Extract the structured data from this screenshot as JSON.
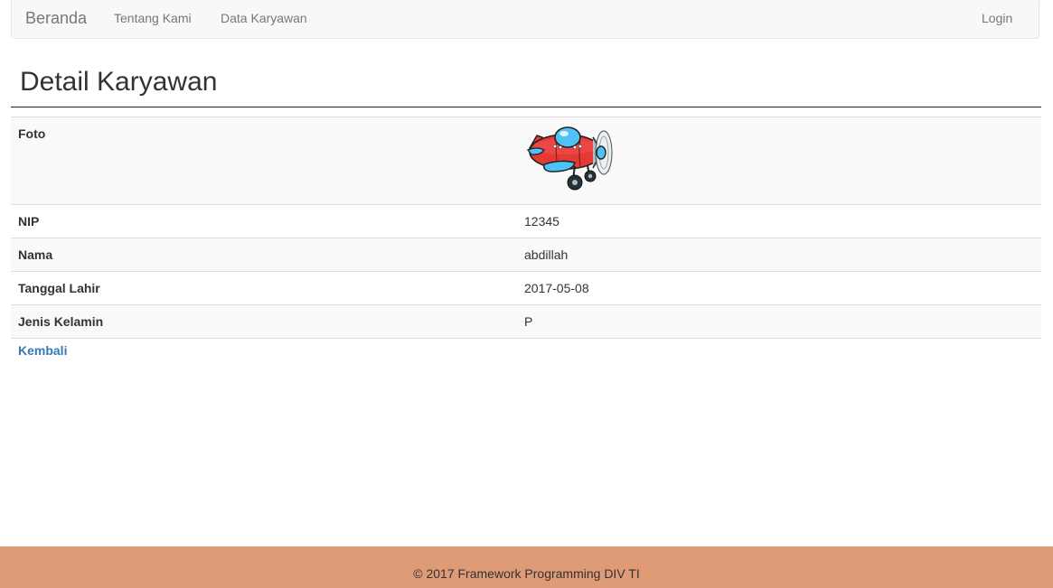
{
  "navbar": {
    "brand": "Beranda",
    "links": [
      "Tentang Kami",
      "Data Karyawan"
    ],
    "login": "Login"
  },
  "page": {
    "title": "Detail Karyawan",
    "rows": [
      {
        "label": "Foto",
        "value": ""
      },
      {
        "label": "NIP",
        "value": "12345"
      },
      {
        "label": "Nama",
        "value": "abdillah"
      },
      {
        "label": "Tanggal Lahir",
        "value": "2017-05-08"
      },
      {
        "label": "Jenis Kelamin",
        "value": "P"
      }
    ],
    "photo_icon": "airplane-cartoon-icon",
    "back_link": "Kembali"
  },
  "footer": {
    "text": "© 2017 Framework Programming DIV TI"
  },
  "colors": {
    "footer_bg": "#df9a76",
    "link": "#337ab7",
    "navbar_bg": "#f8f8f8"
  }
}
